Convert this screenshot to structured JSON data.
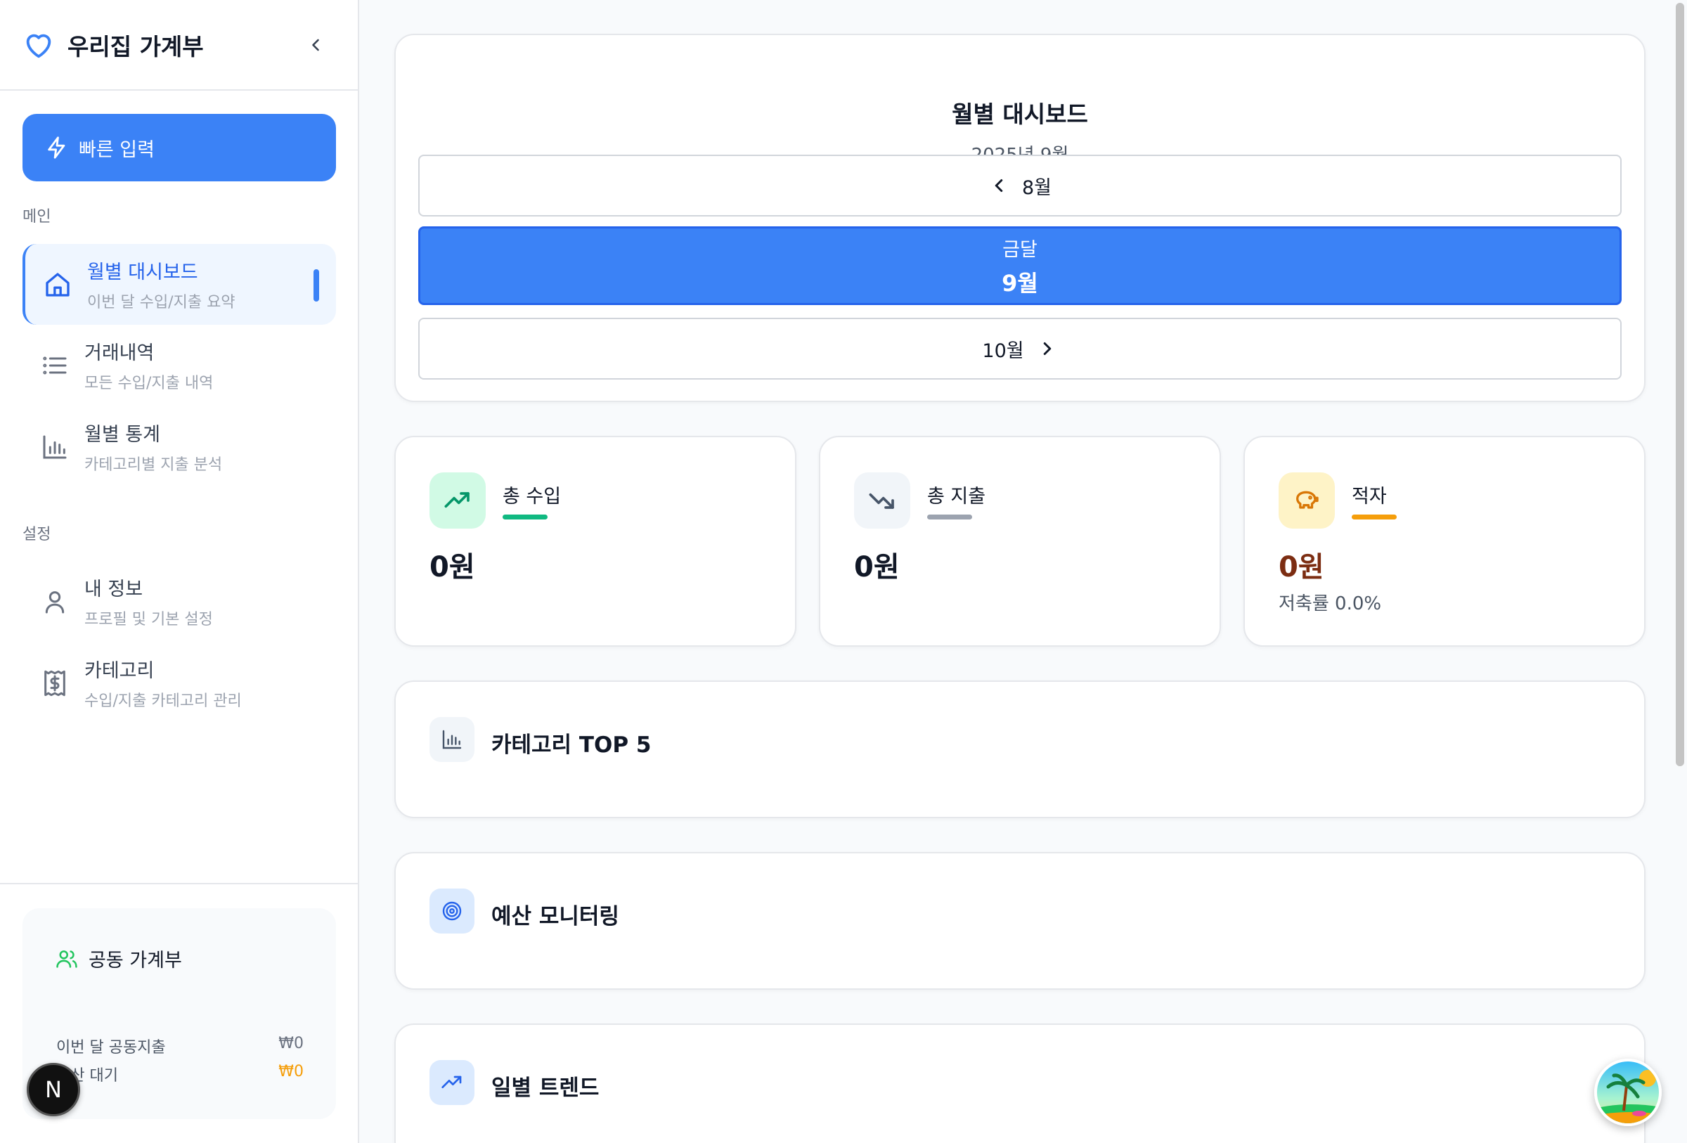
{
  "sidebar": {
    "app_title": "우리집 가계부",
    "quick_input": "빠른 입력",
    "sections": {
      "main": "메인",
      "settings": "설정"
    },
    "items": [
      {
        "title": "월별 대시보드",
        "sub": "이번 달 수입/지출 요약"
      },
      {
        "title": "거래내역",
        "sub": "모든 수입/지출 내역"
      },
      {
        "title": "월별 통계",
        "sub": "카테고리별 지출 분석"
      },
      {
        "title": "내 정보",
        "sub": "프로필 및 기본 설정"
      },
      {
        "title": "카테고리",
        "sub": "수입/지출 카테고리 관리"
      }
    ],
    "shared": {
      "title": "공동 가계부",
      "row1_label": "이번 달 공동지출",
      "row1_value": "₩0",
      "row2_label": "정산 대기",
      "row2_value": "₩0"
    },
    "badge": "N"
  },
  "dashboard": {
    "title": "월별 대시보드",
    "subtitle": "2025년 9월",
    "prev_month": "8월",
    "current_label": "금달",
    "current_month": "9월",
    "next_month": "10월"
  },
  "stats": [
    {
      "label": "총 수입",
      "value": "0원",
      "color": "#10b981"
    },
    {
      "label": "총 지출",
      "value": "0원",
      "color": "#9ca3af"
    },
    {
      "label": "적자",
      "value": "0원",
      "rate": "저축률 0.0%",
      "color": "#f59e0b",
      "value_color": "#7c2d12"
    }
  ],
  "sections": {
    "top5": "카테고리 TOP 5",
    "budget": "예산 모니터링",
    "trend": "일별 트렌드"
  }
}
